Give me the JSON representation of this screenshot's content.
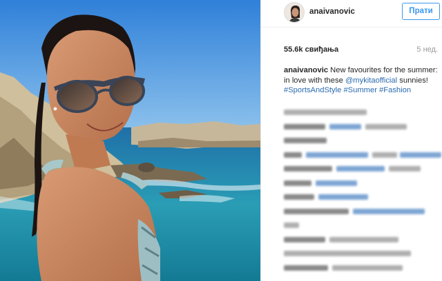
{
  "post": {
    "username": "anaivanovic",
    "follow_label": "Прати",
    "likes": "55.6k свиђања",
    "time_ago": "5 нед.",
    "caption": {
      "username": "anaivanovic",
      "text_1": "New favourites for the summer: in love with these",
      "mention": "@mykitaofficial",
      "text_2": "sunnies!",
      "hashtags": "#SportsAndStyle #Summer #Fashion"
    }
  },
  "colors": {
    "accent": "#3897f0",
    "link": "#2a6ab0",
    "text": "#262626",
    "muted": "#999999"
  }
}
